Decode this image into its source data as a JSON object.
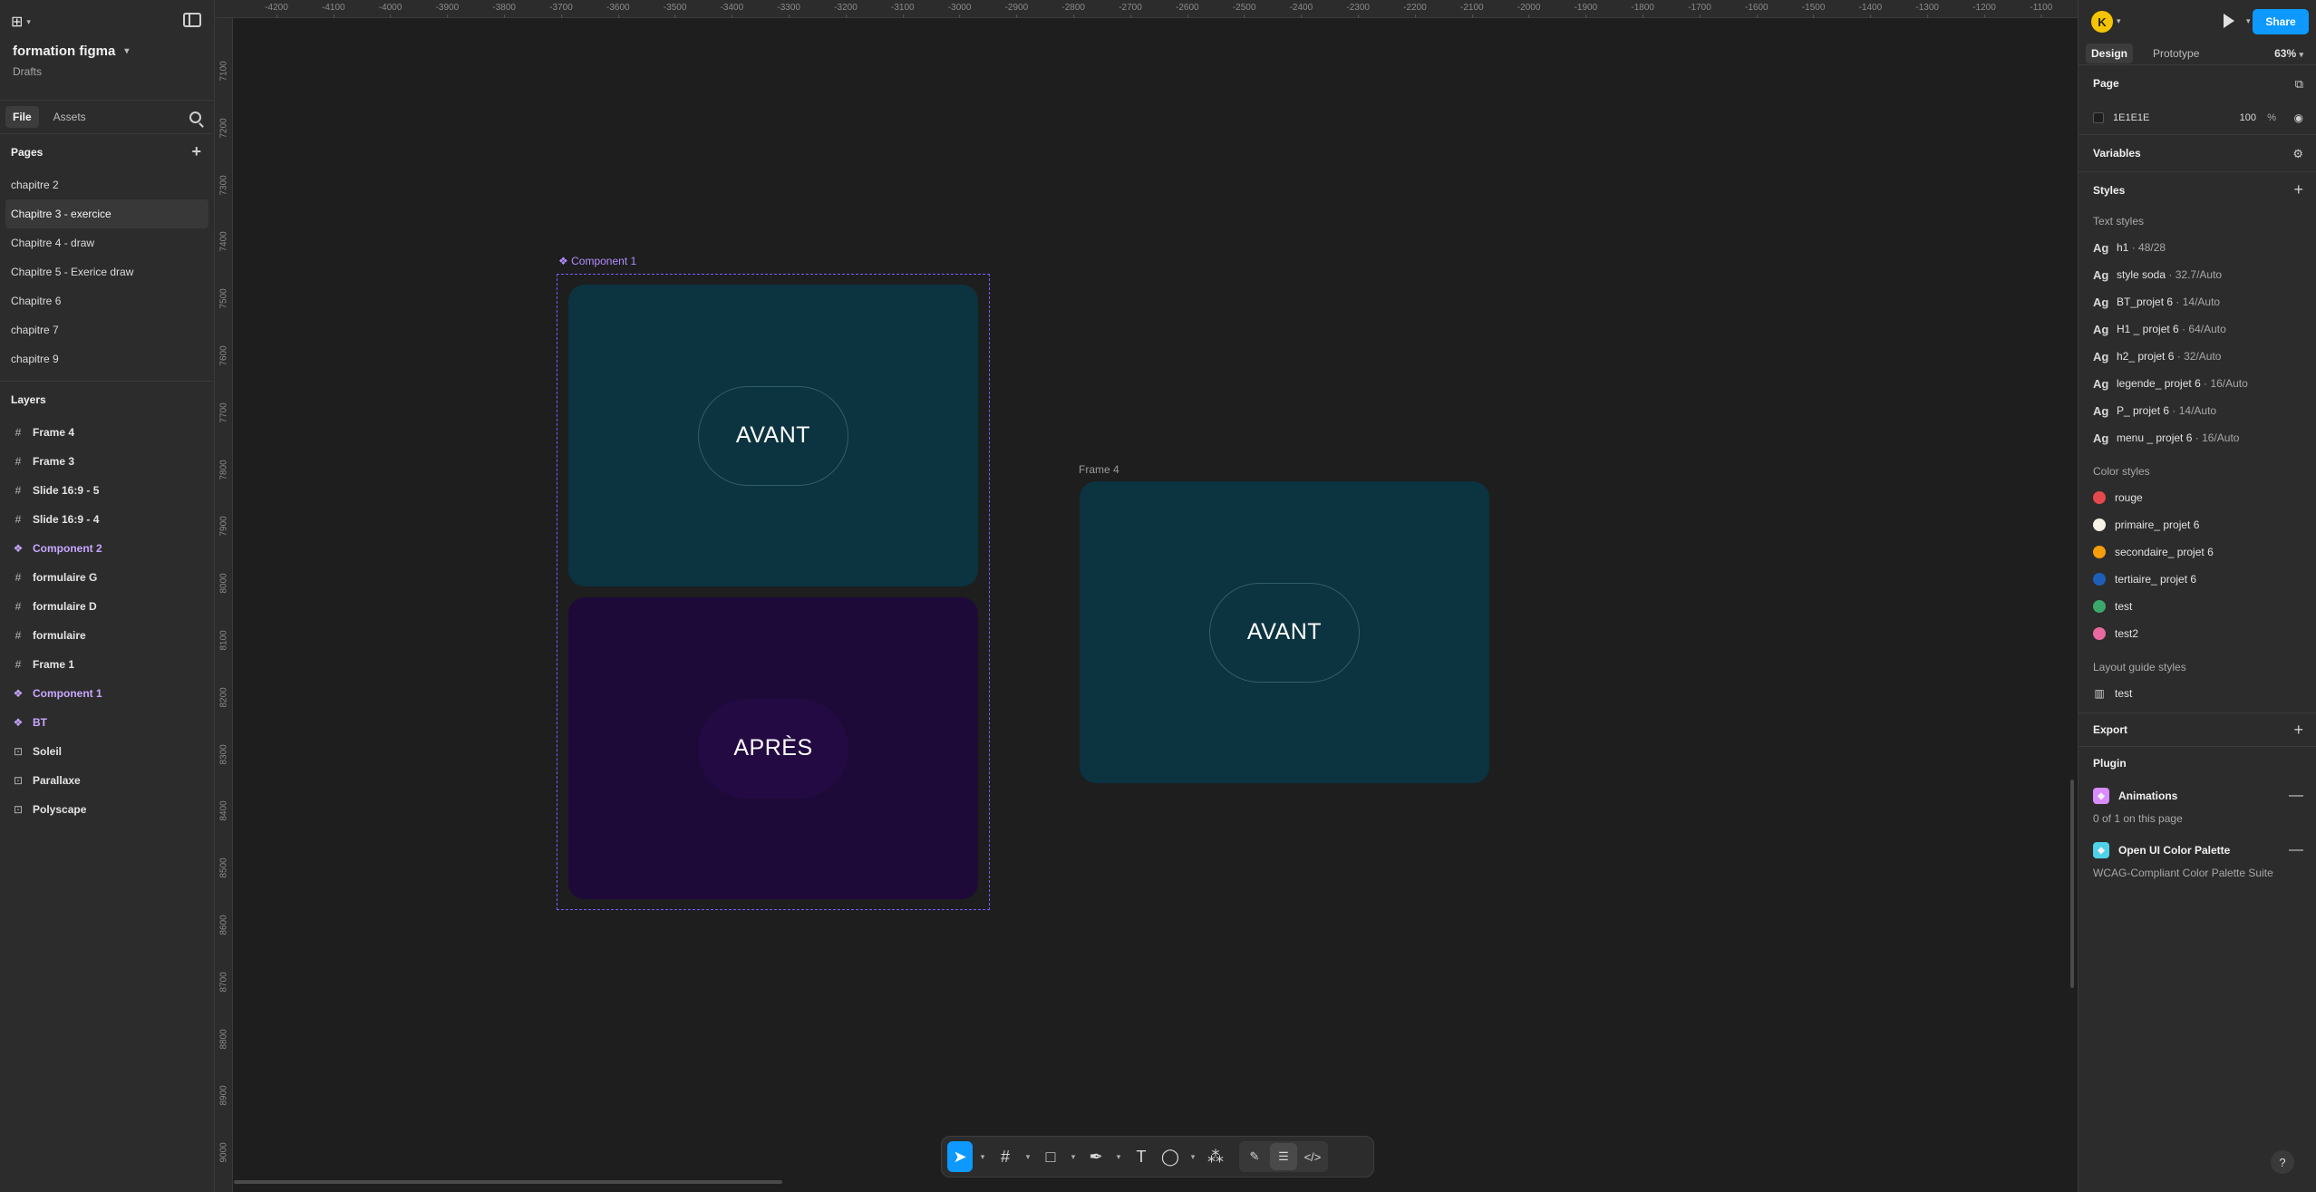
{
  "file": {
    "name": "formation figma",
    "location": "Drafts"
  },
  "left_tabs": [
    "File",
    "Assets"
  ],
  "pages_title": "Pages",
  "pages": [
    {
      "label": "chapitre 2",
      "selected": false
    },
    {
      "label": "Chapitre 3 - exercice",
      "selected": true
    },
    {
      "label": "Chapitre 4 - draw",
      "selected": false
    },
    {
      "label": "Chapitre 5 - Exerice draw",
      "selected": false
    },
    {
      "label": "Chapitre 6",
      "selected": false
    },
    {
      "label": "chapitre 7",
      "selected": false
    },
    {
      "label": "chapitre 9",
      "selected": false
    }
  ],
  "layers_title": "Layers",
  "layers": [
    {
      "label": "Frame 4",
      "icon": "frame-icon",
      "kind": "frame"
    },
    {
      "label": "Frame 3",
      "icon": "frame-icon",
      "kind": "frame"
    },
    {
      "label": "Slide 16:9 - 5",
      "icon": "frame-icon",
      "kind": "frame"
    },
    {
      "label": "Slide 16:9 - 4",
      "icon": "frame-icon",
      "kind": "frame"
    },
    {
      "label": "Component 2",
      "icon": "component-icon",
      "kind": "component"
    },
    {
      "label": "formulaire G",
      "icon": "frame-icon",
      "kind": "frame"
    },
    {
      "label": "formulaire D",
      "icon": "frame-icon",
      "kind": "frame"
    },
    {
      "label": "formulaire",
      "icon": "frame-icon",
      "kind": "frame"
    },
    {
      "label": "Frame 1",
      "icon": "frame-icon",
      "kind": "frame"
    },
    {
      "label": "Component 1",
      "icon": "component-icon",
      "kind": "component"
    },
    {
      "label": "BT",
      "icon": "component-icon",
      "kind": "component"
    },
    {
      "label": "Soleil",
      "icon": "section-icon",
      "kind": "section"
    },
    {
      "label": "Parallaxe",
      "icon": "section-icon",
      "kind": "section"
    },
    {
      "label": "Polyscape",
      "icon": "section-icon",
      "kind": "section"
    }
  ],
  "ruler_top": [
    "-4200",
    "-4100",
    "-4000",
    "-3900",
    "-3800",
    "-3700",
    "-3600",
    "-3500",
    "-3400",
    "-3300",
    "-3200",
    "-3100",
    "-3000",
    "-2900",
    "-2800",
    "-2700",
    "-2600",
    "-2500",
    "-2400",
    "-2300",
    "-2200",
    "-2100",
    "-2000",
    "-1900",
    "-1800",
    "-1700",
    "-1600",
    "-1500",
    "-1400",
    "-1300",
    "-1200",
    "-1100"
  ],
  "ruler_left": [
    "7100",
    "7200",
    "7300",
    "7400",
    "7500",
    "7600",
    "7700",
    "7800",
    "7900",
    "8000",
    "8100",
    "8200",
    "8300",
    "8400",
    "8500",
    "8600",
    "8700",
    "8800",
    "8900",
    "9000"
  ],
  "canvas": {
    "component_label": "Component 1",
    "frame4_label": "Frame 4",
    "variant_top_text": "AVANT",
    "variant_bottom_text": "APRÈS",
    "frame4_text": "AVANT",
    "colors": {
      "teal_card": "#0b3340",
      "violet_card": "#1e0a38",
      "teal_pill": "#0c3340",
      "violet_pill": "#240a43",
      "component_accent": "#7b5cff"
    }
  },
  "toolbar": {
    "tools": [
      "move-icon",
      "frame-icon",
      "rectangle-icon",
      "pen-icon",
      "text-icon",
      "comment-icon",
      "actions-icon"
    ],
    "modes": [
      "draw-mode-icon",
      "design-mode-icon",
      "dev-mode-icon"
    ]
  },
  "header": {
    "avatar_initial": "K",
    "share_label": "Share",
    "tabs": [
      "Design",
      "Prototype"
    ],
    "zoom": "63%"
  },
  "right": {
    "page_title": "Page",
    "page_color": "1E1E1E",
    "page_opacity": "100",
    "page_opacity_unit": "%",
    "variables_title": "Variables",
    "styles_title": "Styles",
    "text_styles_title": "Text styles",
    "text_styles": [
      {
        "name": "h1",
        "meta": "48/28"
      },
      {
        "name": "style soda",
        "meta": "32.7/Auto"
      },
      {
        "name": "BT_projet 6",
        "meta": "14/Auto"
      },
      {
        "name": "H1 _ projet 6",
        "meta": "64/Auto"
      },
      {
        "name": "h2_ projet 6",
        "meta": "32/Auto"
      },
      {
        "name": "legende_ projet 6",
        "meta": "16/Auto"
      },
      {
        "name": "P_ projet 6",
        "meta": "14/Auto"
      },
      {
        "name": "menu _ projet 6",
        "meta": "16/Auto"
      }
    ],
    "color_styles_title": "Color styles",
    "color_styles": [
      {
        "name": "rouge",
        "color": "#e5484d"
      },
      {
        "name": "primaire_ projet 6",
        "color": "#f7f1e6"
      },
      {
        "name": "secondaire_ projet 6",
        "color": "#f59e0b"
      },
      {
        "name": "tertiaire_ projet 6",
        "color": "#1d5fb8"
      },
      {
        "name": "test",
        "color": "#3aa86b"
      },
      {
        "name": "test2",
        "color": "#e86aa0"
      }
    ],
    "layout_title": "Layout guide styles",
    "layout_styles": [
      {
        "name": "test"
      }
    ],
    "export_title": "Export",
    "plugin_title": "Plugin",
    "plugins": [
      {
        "name": "Animations",
        "note": "0 of 1 on this page",
        "color": "#d98cff"
      },
      {
        "name": "Open UI Color Palette",
        "note": "WCAG-Compliant Color Palette Suite",
        "color": "#4fd1e8"
      }
    ],
    "help_label": "?"
  }
}
